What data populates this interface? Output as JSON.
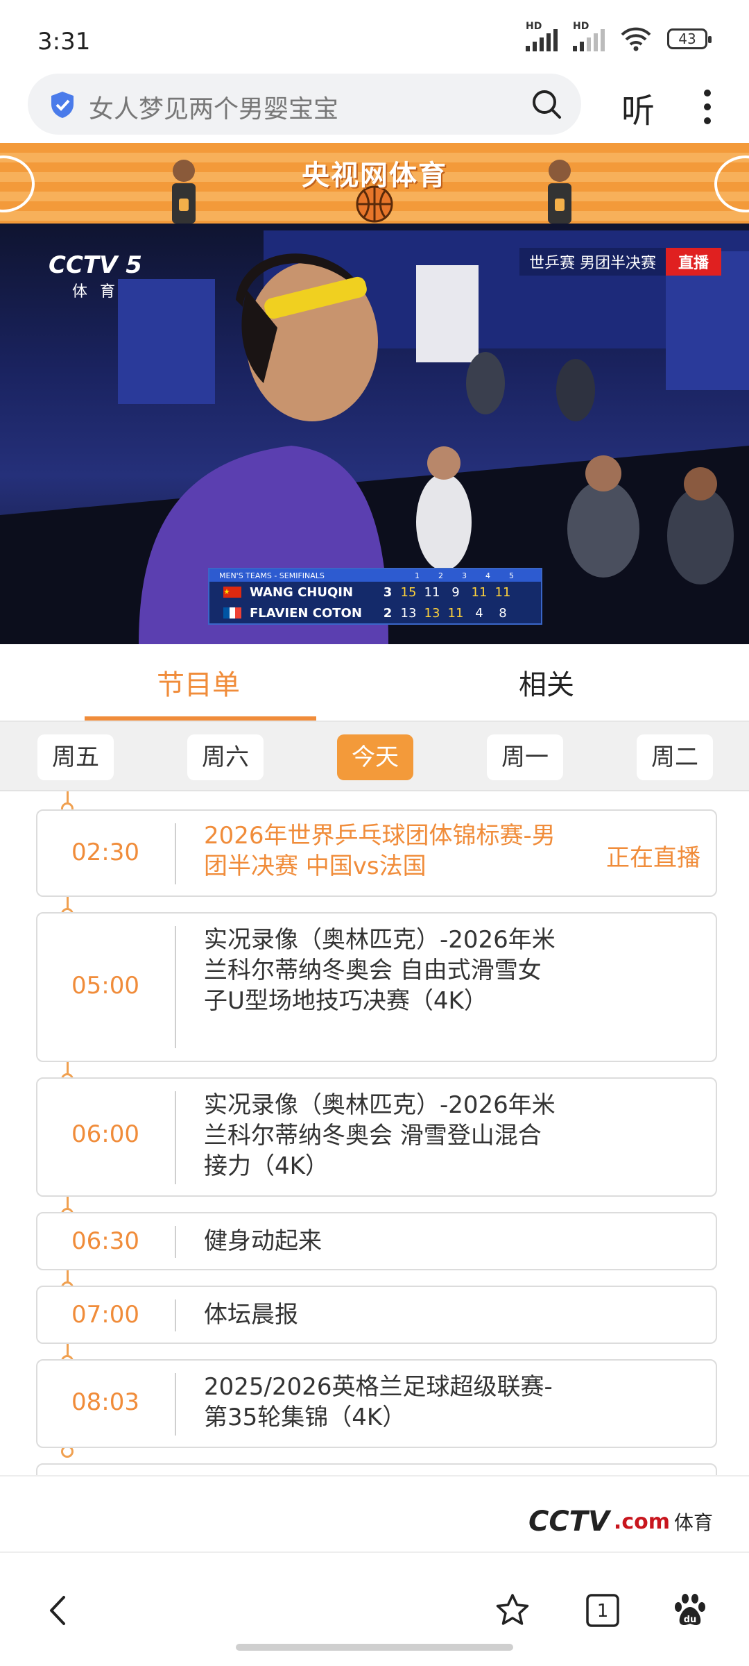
{
  "status_bar": {
    "time": "3:31",
    "signal_1": "HD",
    "signal_2": "HD",
    "battery": "43"
  },
  "search": {
    "query": "女人梦见两个男婴宝宝",
    "listen_label": "听",
    "icons": [
      "shield-icon",
      "search-icon",
      "more-icon"
    ]
  },
  "banner": {
    "title": "央视网体育"
  },
  "video": {
    "channel_logo": "CCTV 5",
    "channel_sub": "体育",
    "event_tag": "世乒赛  男团半决赛",
    "live_tag": "直播",
    "scoreboard": {
      "header": "MEN'S TEAMS - SEMIFINALS",
      "game_numbers": [
        "1",
        "2",
        "3",
        "4",
        "5"
      ],
      "players": [
        {
          "name": "WANG CHUQIN",
          "total": "3",
          "games": [
            "15",
            "11",
            "9",
            "11",
            "11"
          ],
          "flag_color": "#de2910"
        },
        {
          "name": "FLAVIEN COTON",
          "total": "2",
          "games": [
            "13",
            "13",
            "11",
            "4",
            "8"
          ],
          "flag_color": "#0055a4"
        }
      ]
    }
  },
  "tabs": [
    {
      "label": "节目单",
      "active": true
    },
    {
      "label": "相关",
      "active": false
    }
  ],
  "days": [
    {
      "label": "周五",
      "active": false
    },
    {
      "label": "周六",
      "active": false
    },
    {
      "label": "今天",
      "active": true
    },
    {
      "label": "周一",
      "active": false
    },
    {
      "label": "周二",
      "active": false
    }
  ],
  "programs": [
    {
      "time": "02:30",
      "title": "2026年世界乒乓球团体锦标赛-男团半决赛 中国vs法国",
      "status": "正在直播",
      "live": true
    },
    {
      "time": "05:00",
      "title": "实况录像（奥林匹克）-2026年米兰科尔蒂纳冬奥会 自由式滑雪女子U型场地技巧决赛（4K）",
      "status": "",
      "live": false
    },
    {
      "time": "06:00",
      "title": "实况录像（奥林匹克）-2026年米兰科尔蒂纳冬奥会 滑雪登山混合接力（4K）",
      "status": "",
      "live": false
    },
    {
      "time": "06:30",
      "title": "健身动起来",
      "status": "",
      "live": false
    },
    {
      "time": "07:00",
      "title": "体坛晨报",
      "status": "",
      "live": false
    },
    {
      "time": "08:03",
      "title": "2025/2026英格兰足球超级联赛-第35轮集锦（4K）",
      "status": "",
      "live": false
    }
  ],
  "footer": {
    "logo_cctv": "CCTV",
    "logo_com": ".com",
    "logo_text": "体育"
  },
  "colors": {
    "accent": "#f08c3a",
    "live_red": "#e02020"
  }
}
